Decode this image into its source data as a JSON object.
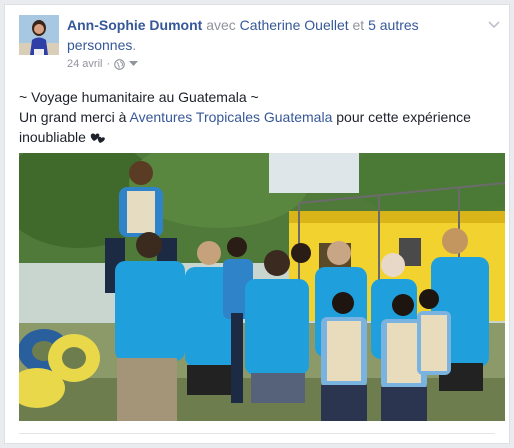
{
  "post": {
    "author": "Ann-Sophie Dumont",
    "with_word": "avec",
    "tagged_person": "Catherine Ouellet",
    "and_word": "et",
    "others_link": "5 autres personnes",
    "period": ".",
    "date": "24 avril",
    "separator": "·",
    "privacy_icon": "globe-icon",
    "menu_icon": "chevron-down-icon",
    "line1": "~ Voyage humanitaire au Guatemala ~",
    "line2_prefix": "Un grand merci à",
    "page_link": "Aventures Tropicales Guatemala",
    "line2_suffix": "pour cette expérience inoubliable",
    "emoji_icon": "two-hearts-icon"
  },
  "colors": {
    "link": "#365899",
    "text": "#1d2129",
    "muted": "#90949c",
    "shirt_blue": "#1fa0dc",
    "wall_yellow": "#f2d22e"
  }
}
